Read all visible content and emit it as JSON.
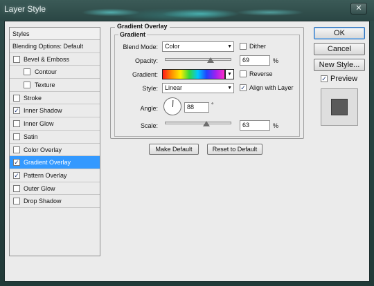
{
  "window": {
    "title": "Layer Style",
    "close_glyph": "✕"
  },
  "styles_list": {
    "header": "Styles",
    "items": [
      {
        "label": "Blending Options: Default",
        "has_checkbox": false,
        "checked": false,
        "indent": false,
        "selected": false
      },
      {
        "label": "Bevel & Emboss",
        "has_checkbox": true,
        "checked": false,
        "indent": false,
        "selected": false
      },
      {
        "label": "Contour",
        "has_checkbox": true,
        "checked": false,
        "indent": true,
        "selected": false
      },
      {
        "label": "Texture",
        "has_checkbox": true,
        "checked": false,
        "indent": true,
        "selected": false
      },
      {
        "label": "Stroke",
        "has_checkbox": true,
        "checked": false,
        "indent": false,
        "selected": false
      },
      {
        "label": "Inner Shadow",
        "has_checkbox": true,
        "checked": true,
        "indent": false,
        "selected": false
      },
      {
        "label": "Inner Glow",
        "has_checkbox": true,
        "checked": false,
        "indent": false,
        "selected": false
      },
      {
        "label": "Satin",
        "has_checkbox": true,
        "checked": false,
        "indent": false,
        "selected": false
      },
      {
        "label": "Color Overlay",
        "has_checkbox": true,
        "checked": false,
        "indent": false,
        "selected": false
      },
      {
        "label": "Gradient Overlay",
        "has_checkbox": true,
        "checked": true,
        "indent": false,
        "selected": true
      },
      {
        "label": "Pattern Overlay",
        "has_checkbox": true,
        "checked": true,
        "indent": false,
        "selected": false
      },
      {
        "label": "Outer Glow",
        "has_checkbox": true,
        "checked": false,
        "indent": false,
        "selected": false
      },
      {
        "label": "Drop Shadow",
        "has_checkbox": true,
        "checked": false,
        "indent": false,
        "selected": false
      }
    ]
  },
  "panel": {
    "group_title": "Gradient Overlay",
    "subgroup_title": "Gradient",
    "blend_mode": {
      "label": "Blend Mode:",
      "value": "Color"
    },
    "dither": {
      "label": "Dither",
      "checked": false
    },
    "opacity": {
      "label": "Opacity:",
      "value": "69",
      "unit": "%",
      "level": 0.69
    },
    "gradient": {
      "label": "Gradient:",
      "colors": [
        "#ff1a1a",
        "#ff8c00",
        "#ffee00",
        "#34d93b",
        "#00c8ff",
        "#2044ff",
        "#a020f0",
        "#ff2cc8"
      ]
    },
    "reverse": {
      "label": "Reverse",
      "checked": false
    },
    "style": {
      "label": "Style:",
      "value": "Linear"
    },
    "align_with_layer": {
      "label": "Align with Layer",
      "checked": true
    },
    "angle": {
      "label": "Angle:",
      "value": "88",
      "unit": "°"
    },
    "scale": {
      "label": "Scale:",
      "value": "63",
      "unit": "%",
      "level": 0.63
    },
    "make_default": "Make Default",
    "reset_to_default": "Reset to Default"
  },
  "buttons": {
    "ok": "OK",
    "cancel": "Cancel",
    "new_style": "New Style...",
    "preview": {
      "label": "Preview",
      "checked": true
    }
  },
  "icons": {
    "check": "✓",
    "dropdown": "▼",
    "close": "close-icon",
    "angle_dial": "angle-dial-icon"
  },
  "colors": {
    "selection": "#3399ff",
    "dialog_bg": "#ebebeb",
    "preview_swatch": "#5a5a5a"
  }
}
